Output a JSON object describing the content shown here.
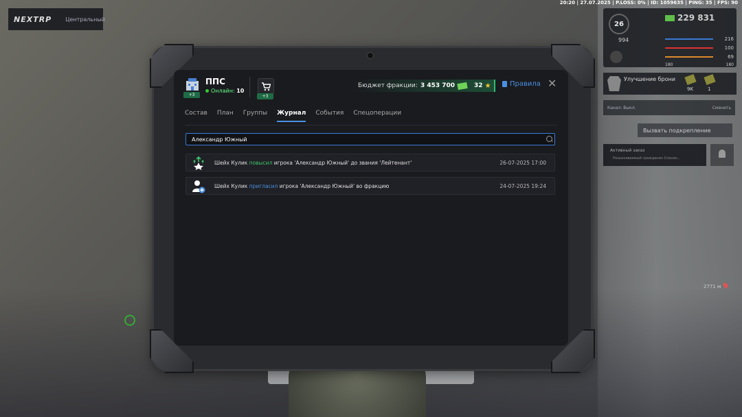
{
  "hud": {
    "top_info": "20:20 | 27.07.2025 | P.LOSS: 0% | ID: 1059635 | PING: 35 | FPS: 90",
    "server_logo": "NEXTRP",
    "server_name": "Центральный",
    "level": "26",
    "money": "229 831",
    "stat_994": "994",
    "stats": [
      {
        "value": "216",
        "color": "#3a7bd5"
      },
      {
        "value": "100",
        "color": "#d33"
      },
      {
        "value": "69",
        "color": "#e08a2b"
      },
      {
        "value": "180",
        "color": "#888"
      }
    ],
    "small_pair": [
      "180",
      "180"
    ],
    "armor": {
      "title": "Улучшение брони",
      "v1": "9K",
      "v2": "1"
    },
    "radio": {
      "label": "Канал: Выкл.",
      "action": "Сменить"
    },
    "backup_button": "Вызвать подкрепление",
    "order": {
      "title": "Активный заказ",
      "subtitle": "Разыскиваемый гражданин Спасио..."
    },
    "distance": "2771 м"
  },
  "faction": {
    "name": "ППС",
    "online_label": "Онлайн:",
    "online_count": "10",
    "badge": "+3",
    "shop_badge": "+3",
    "budget_label": "Бюджет фракции:",
    "budget_value": "3 453 700",
    "stars": "32",
    "rules_label": "Правила"
  },
  "tabs": [
    {
      "label": "Состав",
      "active": false
    },
    {
      "label": "План",
      "active": false
    },
    {
      "label": "Группы",
      "active": false
    },
    {
      "label": "Журнал",
      "active": true
    },
    {
      "label": "События",
      "active": false
    },
    {
      "label": "Спецоперации",
      "active": false
    }
  ],
  "search": {
    "value": "Александр Южный"
  },
  "log": [
    {
      "icon": "promote-icon",
      "actor": "Шейх Кулик",
      "verb": "повысил",
      "verb_color": "#3cc66b",
      "rest": "игрока 'Александр Южный' до звания 'Лейтенант'",
      "time": "26-07-2025 17:00"
    },
    {
      "icon": "invite-user-icon",
      "actor": "Шейх Кулик",
      "verb": "пригласил",
      "verb_color": "#4a90e2",
      "rest": "игрока 'Александр Южный' во фракцию",
      "time": "24-07-2025 19:24"
    }
  ]
}
